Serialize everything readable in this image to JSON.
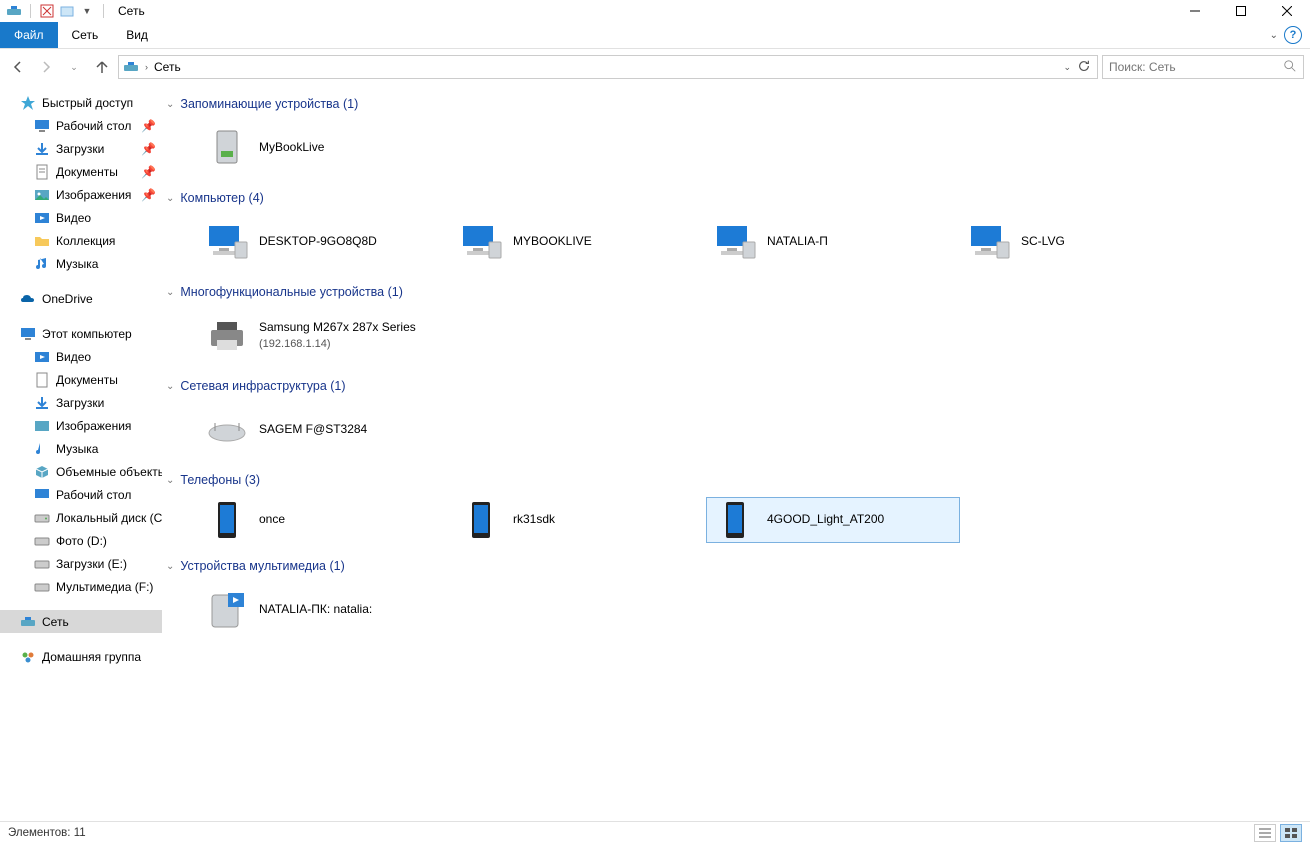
{
  "window": {
    "title": "Сеть"
  },
  "ribbon": {
    "file": "Файл",
    "tabs": [
      "Сеть",
      "Вид"
    ]
  },
  "address": {
    "crumbs": [
      "Сеть"
    ]
  },
  "search": {
    "placeholder": "Поиск: Сеть"
  },
  "tree": {
    "quick_access": "Быстрый доступ",
    "quick_items": [
      {
        "label": "Рабочий стол",
        "pinned": true
      },
      {
        "label": "Загрузки",
        "pinned": true
      },
      {
        "label": "Документы",
        "pinned": true
      },
      {
        "label": "Изображения",
        "pinned": true
      },
      {
        "label": "Видео",
        "pinned": false
      },
      {
        "label": "Коллекция",
        "pinned": false
      },
      {
        "label": "Музыка",
        "pinned": false
      }
    ],
    "onedrive": "OneDrive",
    "this_pc": "Этот компьютер",
    "pc_items": [
      "Видео",
      "Документы",
      "Загрузки",
      "Изображения",
      "Музыка",
      "Объемные объекты",
      "Рабочий стол",
      "Локальный диск (C:)",
      "Фото (D:)",
      "Загрузки (E:)",
      "Мультимедиа (F:)"
    ],
    "network": "Сеть",
    "homegroup": "Домашняя группа"
  },
  "groups": {
    "storage": {
      "title": "Запоминающие устройства (1)",
      "items": [
        "MyBookLive"
      ]
    },
    "computer": {
      "title": "Компьютер (4)",
      "items": [
        "DESKTOP-9GO8Q8D",
        "MYBOOKLIVE",
        "NATALIA-П",
        "SC-LVG"
      ]
    },
    "mfu": {
      "title": "Многофункциональные устройства (1)",
      "items": [
        {
          "name": "Samsung M267x 287x Series",
          "sub": "(192.168.1.14)"
        }
      ]
    },
    "infra": {
      "title": "Сетевая инфраструктура (1)",
      "items": [
        "SAGEM F@ST3284"
      ]
    },
    "phones": {
      "title": "Телефоны (3)",
      "items": [
        "once",
        "rk31sdk",
        "4GOOD_Light_AT200"
      ],
      "selected_index": 2
    },
    "media": {
      "title": "Устройства мультимедиа (1)",
      "items": [
        "NATALIA-ПК: natalia:"
      ]
    }
  },
  "status": {
    "items_label": "Элементов:",
    "count": "11"
  }
}
